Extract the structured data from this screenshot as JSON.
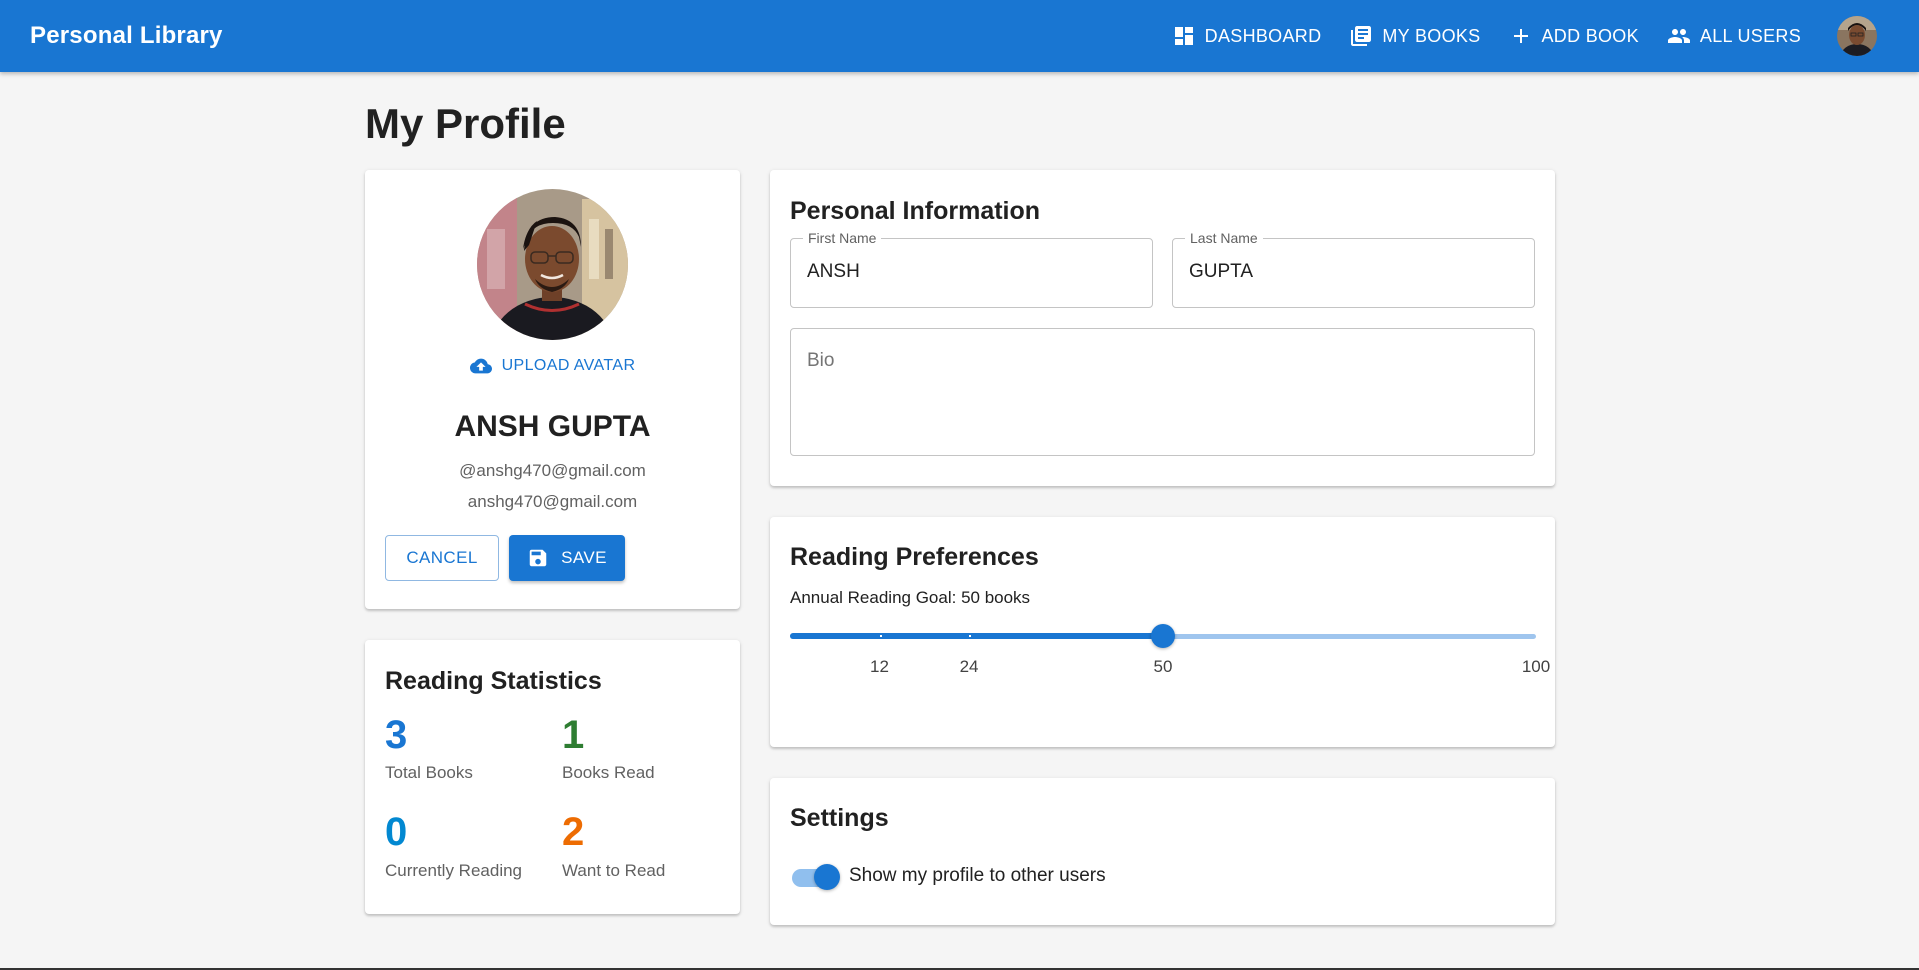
{
  "app": {
    "brand": "Personal Library",
    "nav": [
      {
        "label": "DASHBOARD",
        "icon": "dashboard-icon"
      },
      {
        "label": "MY BOOKS",
        "icon": "library-books-icon"
      },
      {
        "label": "ADD BOOK",
        "icon": "plus-icon"
      },
      {
        "label": "ALL USERS",
        "icon": "people-icon"
      }
    ]
  },
  "page": {
    "title": "My Profile"
  },
  "profile": {
    "upload_label": "UPLOAD AVATAR",
    "name": "ANSH GUPTA",
    "username": "@anshg470@gmail.com",
    "email": "anshg470@gmail.com",
    "cancel_label": "CANCEL",
    "save_label": "SAVE"
  },
  "stats": {
    "title": "Reading Statistics",
    "items": [
      {
        "value": "3",
        "label": "Total Books",
        "color": "#1976d2"
      },
      {
        "value": "1",
        "label": "Books Read",
        "color": "#2e7d32"
      },
      {
        "value": "0",
        "label": "Currently Reading",
        "color": "#0288d1"
      },
      {
        "value": "2",
        "label": "Want to Read",
        "color": "#ed6c02"
      }
    ]
  },
  "personal_info": {
    "title": "Personal Information",
    "first_name_label": "First Name",
    "first_name_value": "ANSH",
    "last_name_label": "Last Name",
    "last_name_value": "GUPTA",
    "bio_placeholder": "Bio"
  },
  "reading_prefs": {
    "title": "Reading Preferences",
    "goal_label": "Annual Reading Goal: 50 books",
    "goal_value": 50,
    "min": 0,
    "max": 100,
    "marks": [
      {
        "value": 12,
        "label": "12"
      },
      {
        "value": 24,
        "label": "24"
      },
      {
        "value": 50,
        "label": "50"
      },
      {
        "value": 100,
        "label": "100"
      }
    ]
  },
  "settings": {
    "title": "Settings",
    "show_profile_label": "Show my profile to other users",
    "show_profile_enabled": true
  },
  "colors": {
    "primary": "#1976d2",
    "background": "#f5f5f5"
  }
}
